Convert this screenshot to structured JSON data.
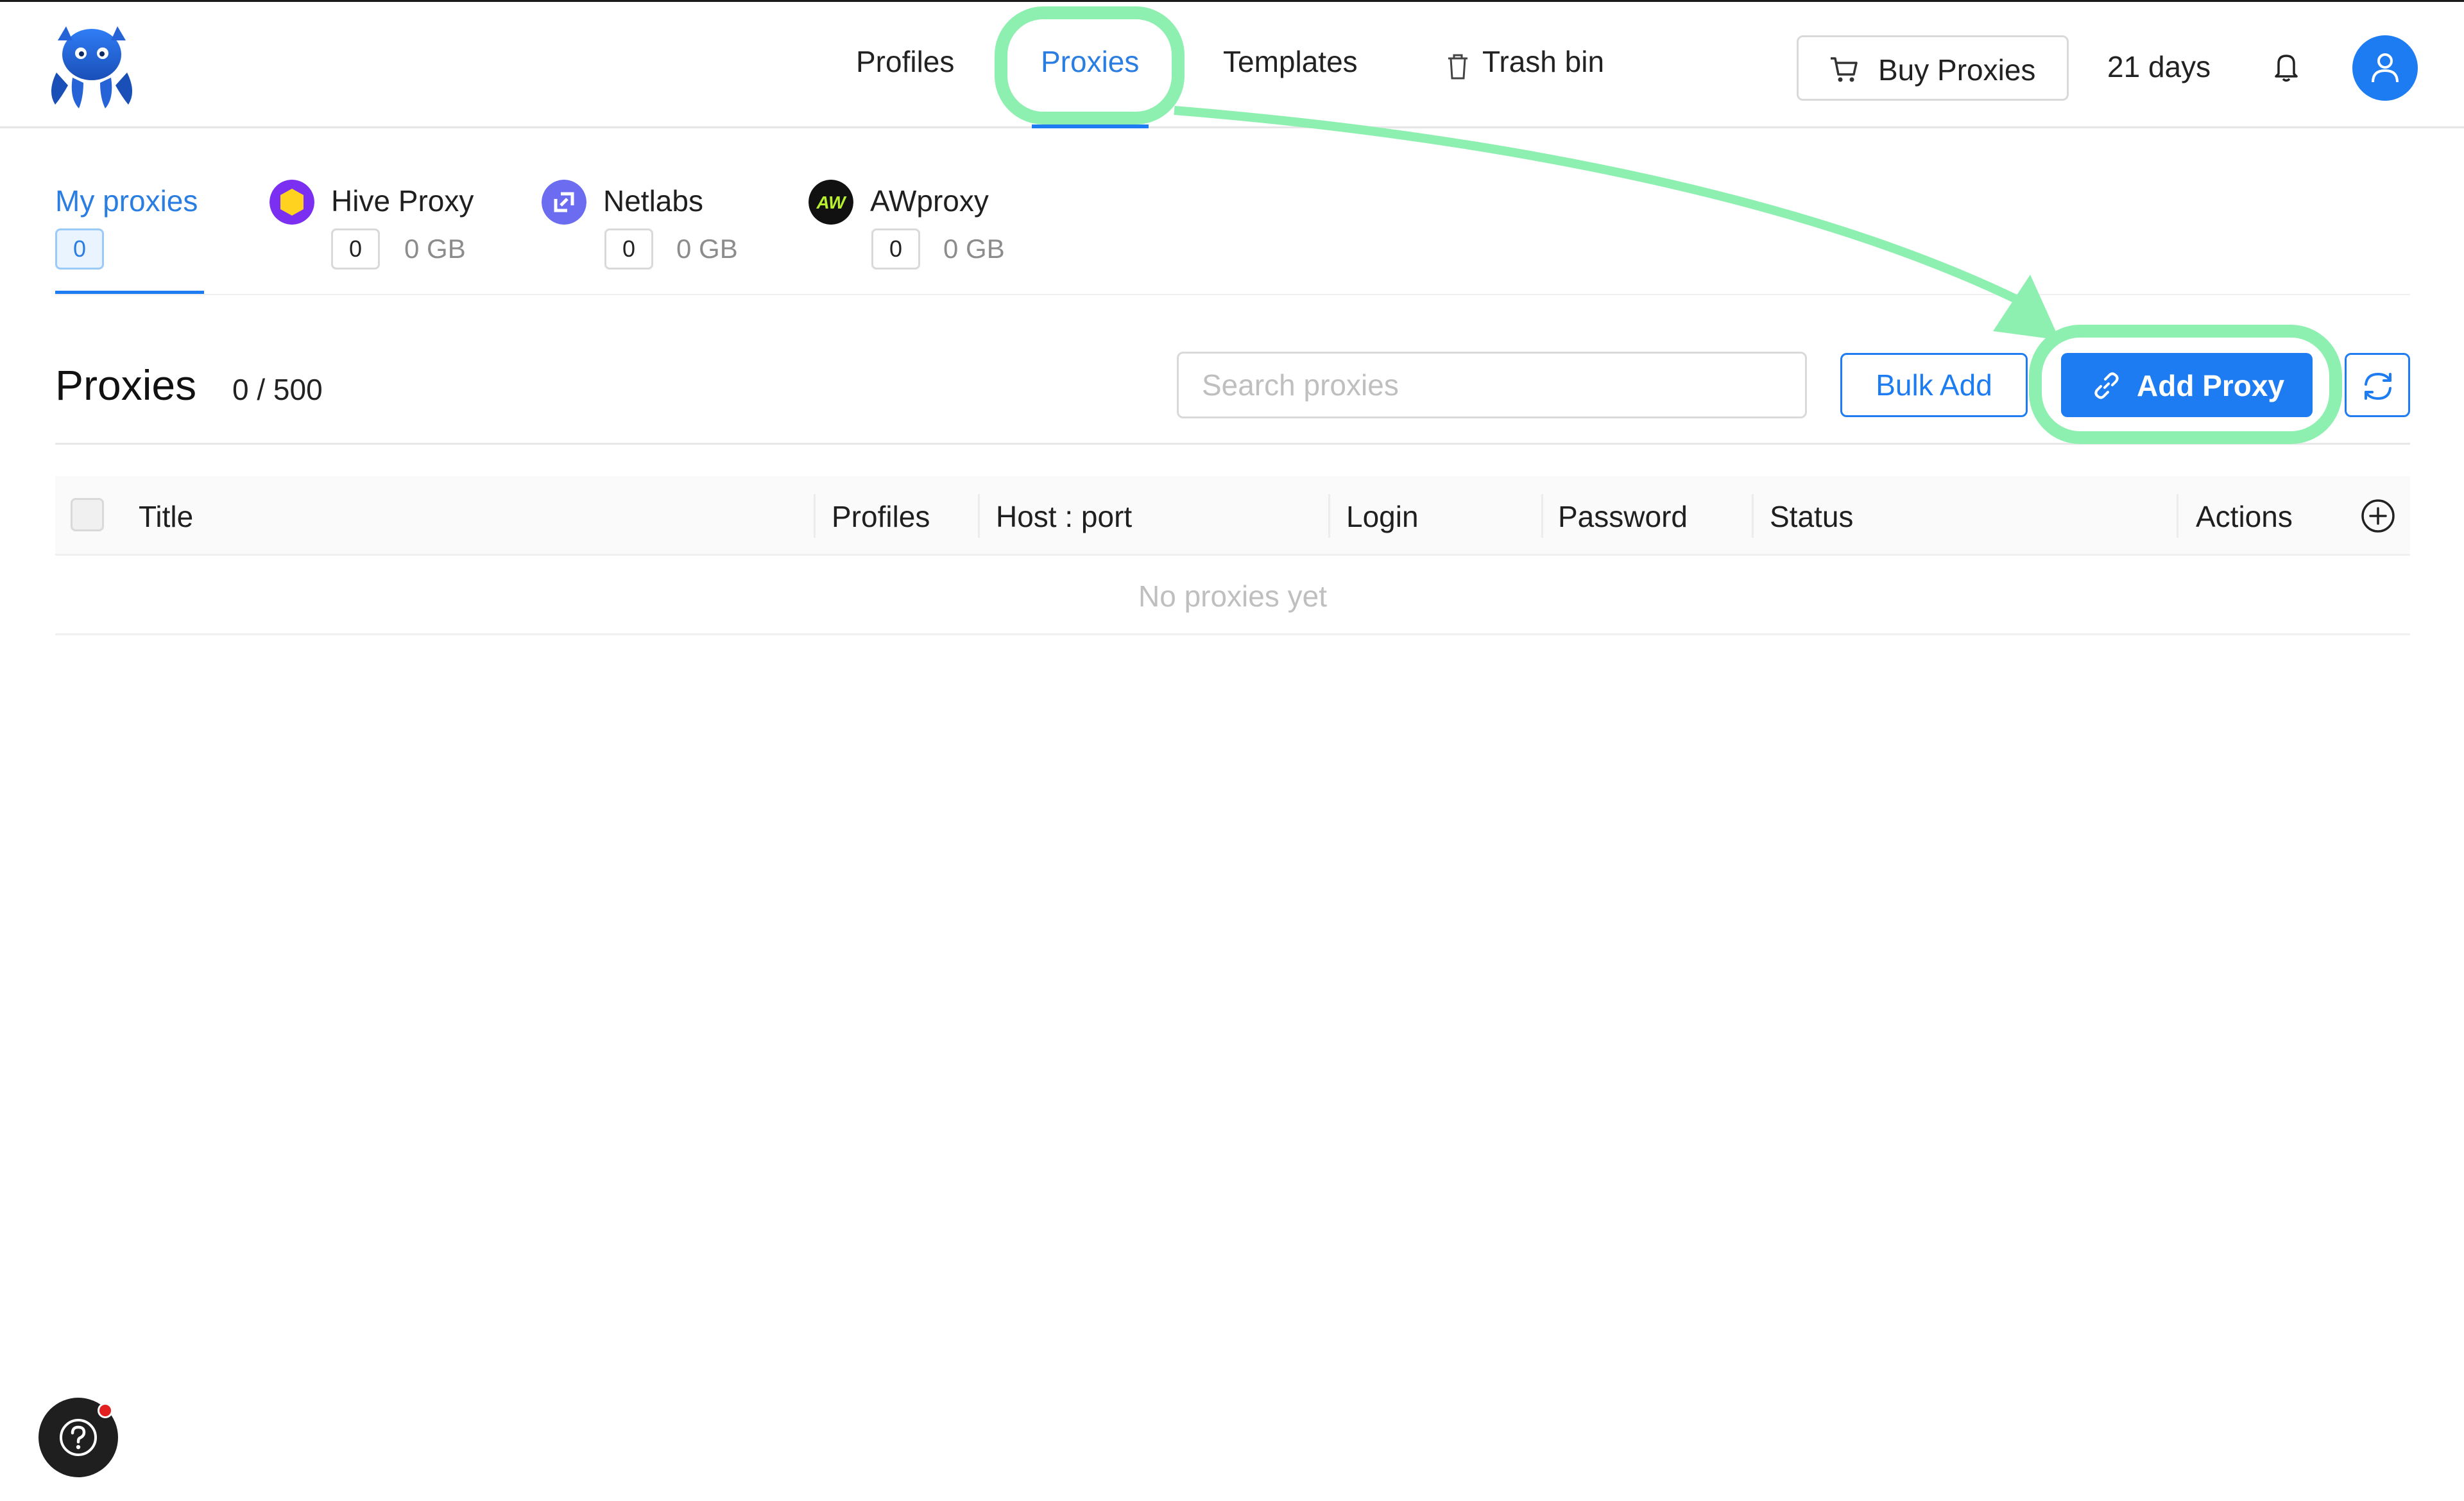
{
  "nav": {
    "profiles": "Profiles",
    "proxies": "Proxies",
    "templates": "Templates",
    "trash": "Trash bin",
    "buy_proxies": "Buy Proxies",
    "days": "21 days"
  },
  "tabs": [
    {
      "label": "My proxies",
      "count": "0",
      "active": true
    },
    {
      "label": "Hive Proxy",
      "count": "0",
      "traffic": "0 GB",
      "icon": "hive-proxy-icon"
    },
    {
      "label": "Netlabs",
      "count": "0",
      "traffic": "0 GB",
      "icon": "netlabs-icon"
    },
    {
      "label": "AWproxy",
      "count": "0",
      "traffic": "0 GB",
      "icon": "awproxy-icon",
      "icon_text": "AW"
    }
  ],
  "section": {
    "title": "Proxies",
    "count": "0 / 500",
    "search_placeholder": "Search proxies",
    "bulk_add": "Bulk Add",
    "add_proxy": "Add Proxy"
  },
  "table": {
    "columns": [
      "Title",
      "Profiles",
      "Host : port",
      "Login",
      "Password",
      "Status",
      "Actions"
    ],
    "empty": "No proxies yet"
  },
  "colors": {
    "accent": "#1e7cf2",
    "highlight": "#8ef0b0",
    "hive": "#7b2ff0",
    "hive_inner": "#ffd21f",
    "netlabs": "#6b6cf0",
    "awproxy": "#111111",
    "awproxy_text": "#b8f030"
  }
}
